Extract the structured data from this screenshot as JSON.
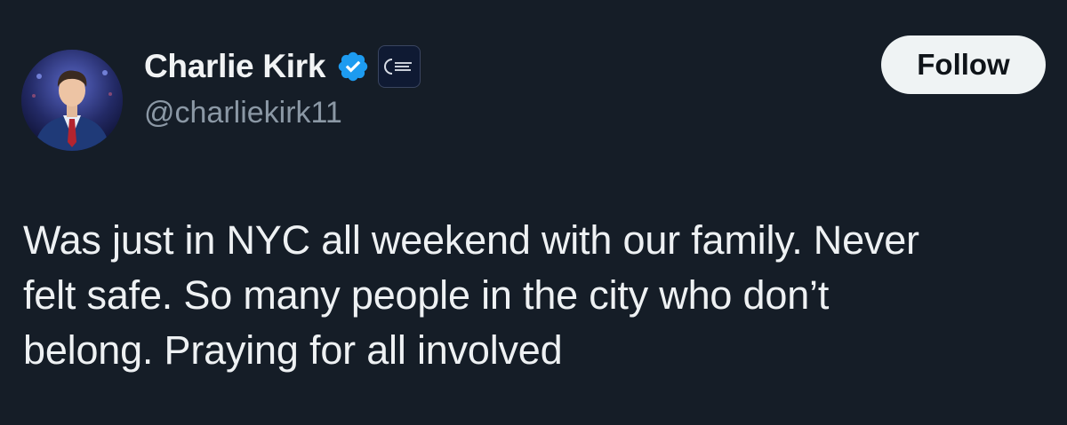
{
  "author": {
    "display_name": "Charlie Kirk",
    "handle": "@charliekirk11",
    "verified_icon": "verified-badge-icon",
    "affiliate_badge_icon": "organization-logo-icon",
    "avatar_icon": "profile-photo"
  },
  "actions": {
    "follow_label": "Follow"
  },
  "tweet": {
    "text_lines": [
      "Was just in NYC all weekend with our family. Never",
      "felt safe. So many people in the city who don’t",
      "belong. Praying for all involved"
    ]
  },
  "colors": {
    "background": "#151d27",
    "verified_blue": "#1d9bf0",
    "handle_gray": "#8b98a5",
    "button_bg": "#eff3f4"
  }
}
